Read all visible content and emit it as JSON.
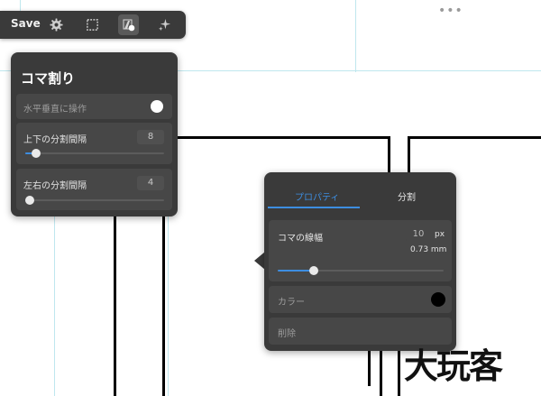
{
  "toolbar": {
    "save_label": "Save",
    "icons": [
      "gear-icon",
      "selection-icon",
      "panel-tool-icon",
      "sparkle-icon"
    ]
  },
  "panel_split": {
    "title": "コマ割り",
    "rows": [
      {
        "label": "水平垂直に操作",
        "toggle_on": true
      },
      {
        "label": "上下の分割間隔",
        "value": "8",
        "slider_fraction": 0.08
      },
      {
        "label": "左右の分割間隔",
        "value": "4",
        "slider_fraction": 0.03
      }
    ]
  },
  "panel_props": {
    "tabs": [
      {
        "label": "プロパティ",
        "active": true
      },
      {
        "label": "分割",
        "active": false
      }
    ],
    "line_width": {
      "label": "コマの線幅",
      "value": "10",
      "unit": "px",
      "mm": "0.73 mm",
      "slider_fraction": 0.22
    },
    "color": {
      "label": "カラー",
      "value": "#000000"
    },
    "delete_label": "削除"
  },
  "watermark": "大玩客",
  "colors": {
    "panel": "#3a3a3a",
    "accent": "#3d8de0"
  }
}
